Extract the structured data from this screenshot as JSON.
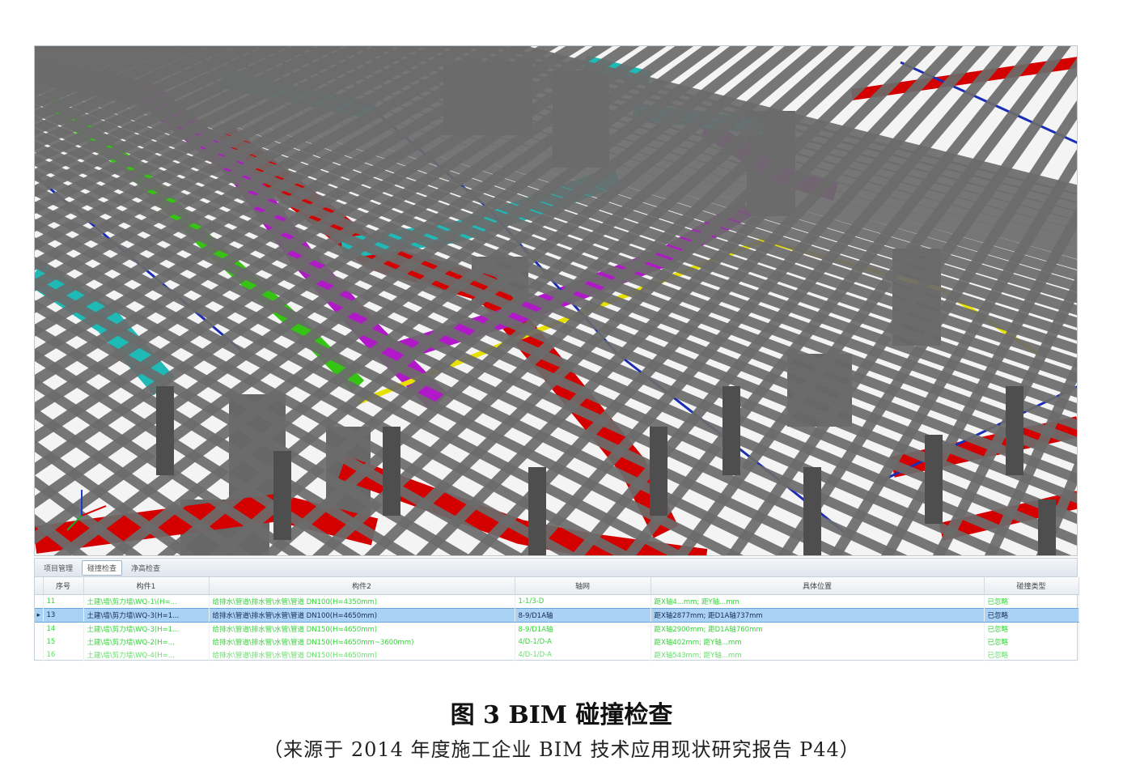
{
  "viewport": {
    "colors": {
      "background": "#f4f4f4",
      "concrete": "#6c6c6c",
      "concrete_dark": "#4e4e4e",
      "pipe_red": "#d40000",
      "duct_purple": "#b018c8",
      "duct_cyan": "#1fb9b6",
      "pipe_green": "#36c414",
      "pipe_yellow": "#e8e000",
      "pipe_blue": "#1a2db4"
    }
  },
  "panel": {
    "tabs": [
      "项目管理",
      "碰撞检查",
      "净高检查"
    ],
    "columns": [
      "序号",
      "构件1",
      "构件2",
      "轴网",
      "具体位置",
      "碰撞类型"
    ],
    "rows": [
      {
        "no": "11",
        "c1": "土建\\墙\\剪力墙\\WQ-1\\(H=...",
        "c2": "给排水\\管道\\排水管\\水管\\管道 DN100(H=4350mm)",
        "axis": "1-1/3-D",
        "pos": "距X轴4...mm; 距Y轴...mm",
        "type": "已忽略"
      },
      {
        "no": "13",
        "c1": "土建\\墙\\剪力墙\\WQ-3(H=1...",
        "c2": "给排水\\管道\\排水管\\水管\\管道 DN100(H=4650mm)",
        "axis": "8-9/D1A轴",
        "pos": "距X轴2877mm; 距D1A轴737mm",
        "type": "已忽略"
      },
      {
        "no": "14",
        "c1": "土建\\墙\\剪力墙\\WQ-3(H=1...",
        "c2": "给排水\\管道\\排水管\\水管\\管道 DN150(H=4650mm)",
        "axis": "8-9/D1A轴",
        "pos": "距X轴2900mm; 距D1A轴760mm",
        "type": "已忽略"
      },
      {
        "no": "15",
        "c1": "土建\\墙\\剪力墙\\WQ-2(H=...",
        "c2": "给排水\\管道\\排水管\\水管\\管道 DN150(H=4650mm~3600mm)",
        "axis": "4/D-1/D-A",
        "pos": "距X轴402mm; 距Y轴...mm",
        "type": "已忽略"
      },
      {
        "no": "16",
        "c1": "土建\\墙\\剪力墙\\WQ-4(H=...",
        "c2": "给排水\\管道\\排水管\\水管\\管道 DN150(H=4650mm)",
        "axis": "4/D-1/D-A",
        "pos": "距X轴543mm; 距Y轴...mm",
        "type": "已忽略"
      }
    ],
    "selected_row": 1
  },
  "caption": "图 3   BIM 碰撞检查",
  "source": "（来源于 2014 年度施工企业 BIM 技术应用现状研究报告 P44）"
}
